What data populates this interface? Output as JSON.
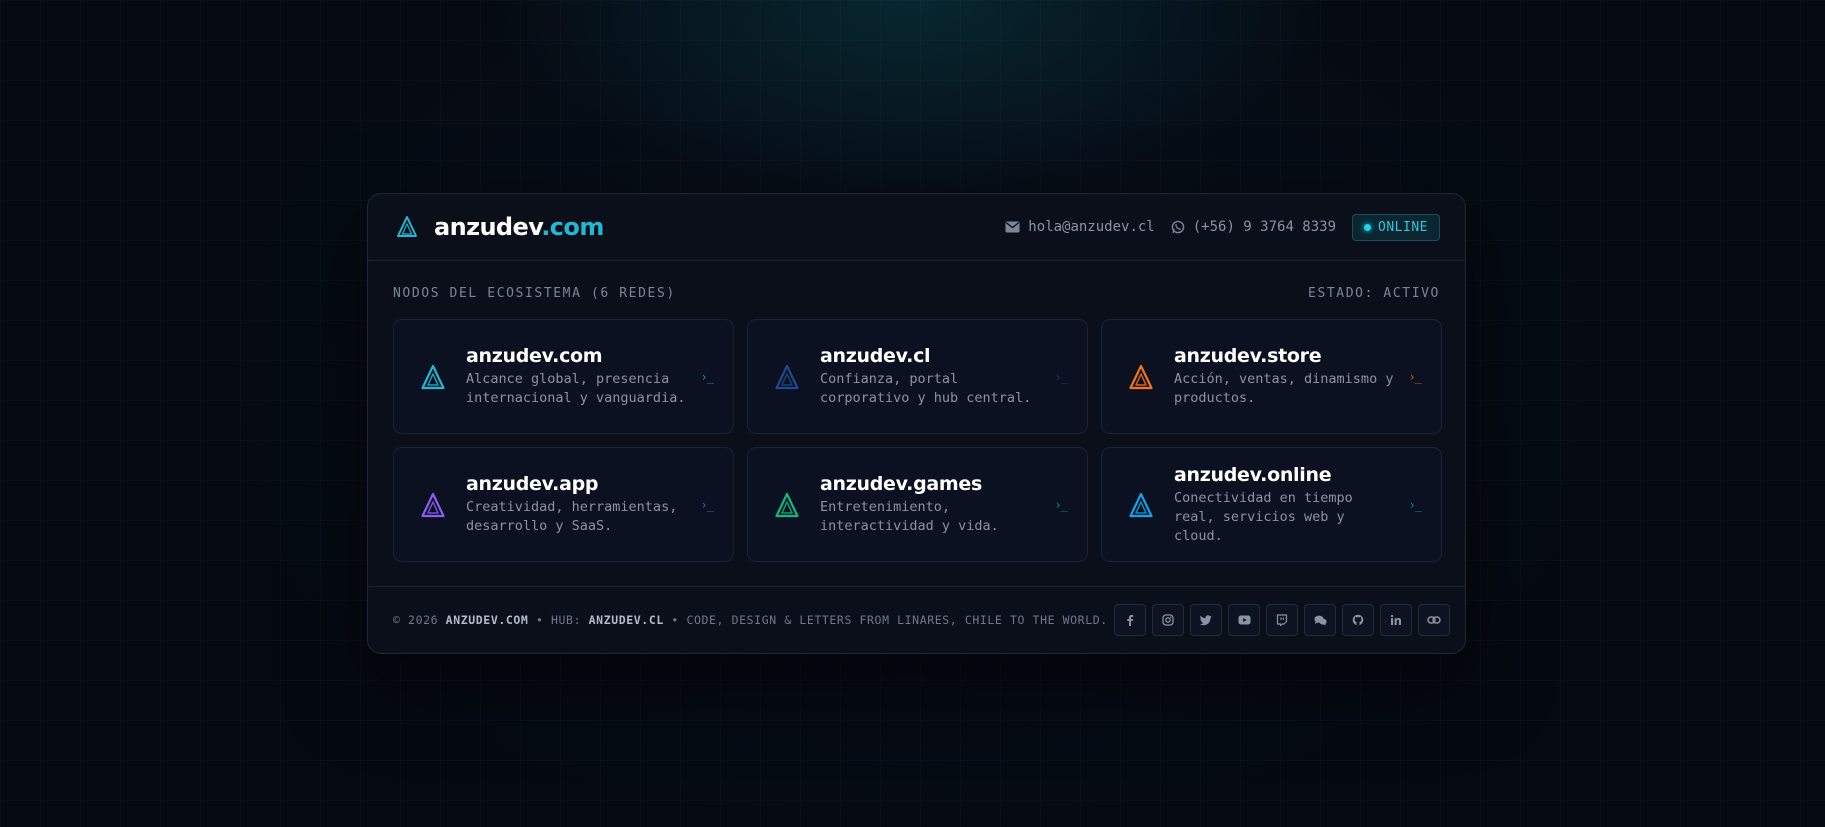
{
  "header": {
    "brand_main": "anzudev",
    "brand_tld": ".com",
    "email": "hola@anzudev.cl",
    "phone": "(+56) 9 3764 8339",
    "status": "ONLINE",
    "logo_icon": "triangle-logo-icon",
    "email_icon": "envelope-icon",
    "phone_icon": "whatsapp-icon"
  },
  "section": {
    "title": "NODOS DEL ECOSISTEMA (6 REDES)",
    "state": "ESTADO: ACTIVO"
  },
  "cards": [
    {
      "title": "anzudev.com",
      "desc": "Alcance global, presencia internacional y vanguardia.",
      "arrow": "›_",
      "color": "#22b8d4"
    },
    {
      "title": "anzudev.cl",
      "desc": "Confianza, portal corporativo y hub central.",
      "arrow": "›_",
      "color": "#1e4a8f"
    },
    {
      "title": "anzudev.store",
      "desc": "Acción, ventas, dinamismo y productos.",
      "arrow": "›_",
      "color": "#f97316"
    },
    {
      "title": "anzudev.app",
      "desc": "Creatividad, herramientas, desarrollo y SaaS.",
      "arrow": "›_",
      "color": "#8b5cf6"
    },
    {
      "title": "anzudev.games",
      "desc": "Entretenimiento, interactividad y vida.",
      "arrow": "›_",
      "color": "#10b981"
    },
    {
      "title": "anzudev.online",
      "desc": "Conectividad en tiempo real, servicios web y cloud.",
      "arrow": "›_",
      "color": "#0ea5e9"
    }
  ],
  "footer": {
    "copyright": "© 2026 ",
    "site": "ANZUDEV.COM",
    "sep1": " • HUB: ",
    "hub": "ANZUDEV.CL",
    "tagline": " • CODE, DESIGN & LETTERS FROM LINARES, CHILE TO THE WORLD."
  },
  "socials": [
    {
      "name": "facebook-icon"
    },
    {
      "name": "instagram-icon"
    },
    {
      "name": "twitter-icon"
    },
    {
      "name": "youtube-icon"
    },
    {
      "name": "twitch-icon"
    },
    {
      "name": "chat-icon"
    },
    {
      "name": "github-icon"
    },
    {
      "name": "linkedin-icon"
    },
    {
      "name": "link-icon"
    }
  ],
  "colors": {
    "accent": "#22b8d4",
    "background": "#050a12",
    "panel": "#0a0f1a"
  }
}
